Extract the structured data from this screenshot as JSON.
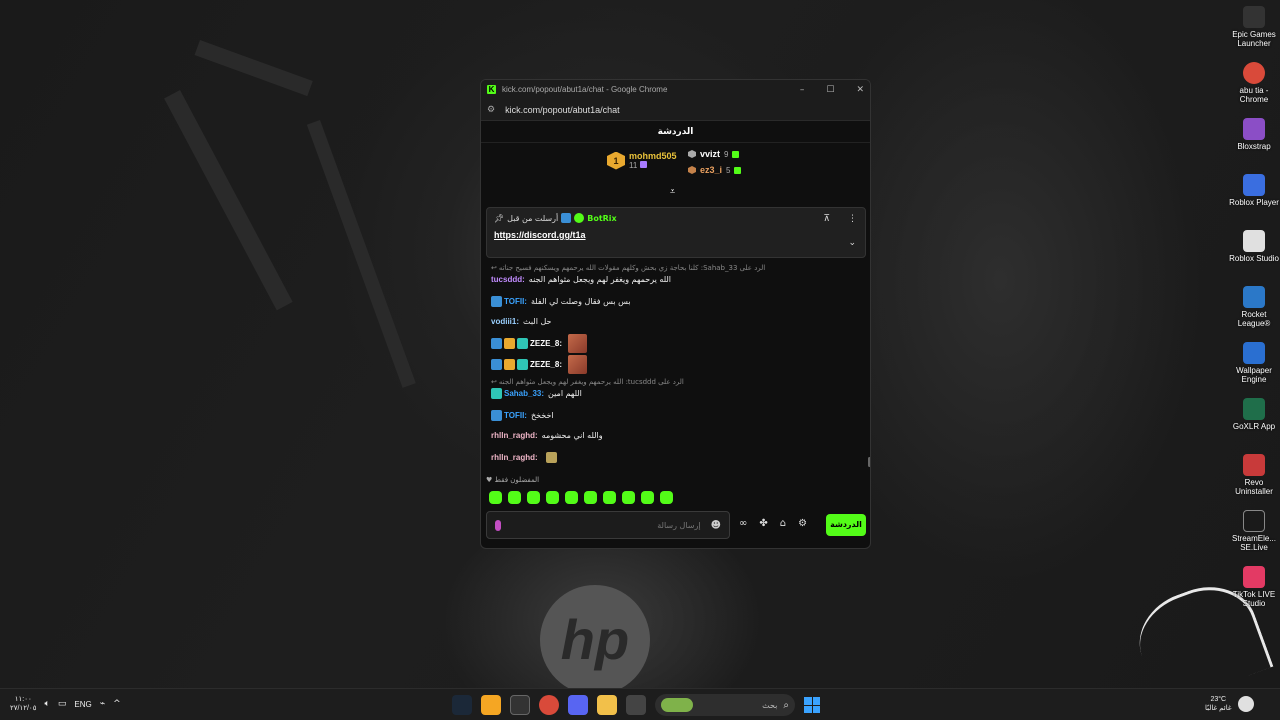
{
  "window": {
    "title": "kick.com/popout/abut1a/chat - Google Chrome",
    "url": "kick.com/popout/abut1a/chat",
    "favicon": "K"
  },
  "chat": {
    "header": "الدردشة",
    "leaderboard": {
      "first": {
        "rank": "1",
        "name": "mohmd505",
        "count": "11"
      },
      "second": {
        "name": "vvizt",
        "count": "9"
      },
      "third": {
        "name": "ez3_i",
        "count": "5"
      }
    },
    "pinned": {
      "label": "أرسلت من قبل",
      "author": "BotRix",
      "link": "https://discord.gg/t1a"
    },
    "messages": [
      {
        "reply": "كلنا بحاجة زي بحش وكلهم مقولات الله يرحمهم ويسكنهم فسيح جناته :Sahab_33 الرد على",
        "user": "tucsddd:",
        "user_color": "#c28cff",
        "text": "الله يرحمهم ويغفر لهم ويجعل مثواهم الجنه"
      },
      {
        "user": "TOFII:",
        "user_color": "#3aa3ff",
        "text": "بس بس فقال وصلت لي الفلة"
      },
      {
        "user": "vodiii1:",
        "user_color": "#9ad0ff",
        "text": "حل البث"
      },
      {
        "user": "ZEZE_8:",
        "user_color": "#ffffff",
        "text": ""
      },
      {
        "user": "ZEZE_8:",
        "user_color": "#ffffff",
        "text": ""
      },
      {
        "reply": "الله يرحمهم ويغفر لهم ويجعل مثواهم الجنه :tucsddd الرد على",
        "user": "Sahab_33:",
        "user_color": "#3aa3ff",
        "text": "اللهم امين"
      },
      {
        "user": "TOFII:",
        "user_color": "#3aa3ff",
        "text": "اخخخخ"
      },
      {
        "user": "rhlln_raghd:",
        "user_color": "#f0b6c8",
        "text": "والله اني محشومه"
      },
      {
        "user": "rhlln_raghd:",
        "user_color": "#f0b6c8",
        "text": ""
      }
    ],
    "favorites_label": "المفضلون فقط",
    "input_placeholder": "إرسال رسالة",
    "send_button": "الدردشة",
    "accent": "#53fc18"
  },
  "desktop_icons": [
    {
      "label": "Epic Games Launcher",
      "color": "#333333"
    },
    {
      "label": "abu tia - Chrome",
      "color": "#d94a3a"
    },
    {
      "label": "Bloxstrap",
      "color": "#8b4ec6"
    },
    {
      "label": "Roblox Player",
      "color": "#3a6ee0"
    },
    {
      "label": "Roblox Studio",
      "color": "#e0e0e0"
    },
    {
      "label": "Rocket League®",
      "color": "#2b78c8"
    },
    {
      "label": "Wallpaper Engine",
      "color": "#2a6fd1"
    },
    {
      "label": "GoXLR App",
      "color": "#1f6e4a"
    },
    {
      "label": "Revo Uninstaller",
      "color": "#c83a3a"
    },
    {
      "label": "StreamEle... SE.Live",
      "color": "#1a1a1a"
    },
    {
      "label": "TikTok LIVE Studio",
      "color": "#e33a64"
    }
  ],
  "taskbar": {
    "time": "١١:٠٠",
    "date": "٢٧/١٢/٠٥",
    "lang": "ENG",
    "search_placeholder": "بحث",
    "weather_temp": "23°C",
    "weather_desc": "غائم غالبًا"
  }
}
